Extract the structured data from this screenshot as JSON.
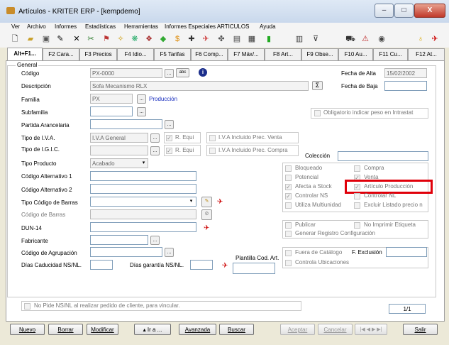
{
  "window": {
    "title": "Artículos - KRITER ERP - [kempdemo]",
    "min": "–",
    "max": "□",
    "close": "X"
  },
  "menu": [
    "Ver",
    "Archivo",
    "Informes",
    "Estadísticas",
    "Herramientas",
    "Informes Especiales ARTICULOS",
    "Ayuda"
  ],
  "tabs": [
    "Alt+F1...",
    "F2 Cara...",
    "F3 Precios",
    "F4 Idio...",
    "F5 Tarifas",
    "F6 Comp...",
    "F7 Máx/...",
    "F8 Art...",
    "F9 Obse...",
    "F10 Au...",
    "F11 Cu...",
    "F12 At..."
  ],
  "general_label": "General",
  "labels": {
    "codigo": "Código",
    "descripcion": "Descripción",
    "familia": "Familia",
    "subfamilia": "Subfamilia",
    "partida": "Partida Arancelaria",
    "tipo_iva": "Tipo de I.V.A.",
    "tipo_igic": "Tipo de I.G.I.C.",
    "tipo_producto": "Tipo Producto",
    "cod_alt1": "Código Alternativo 1",
    "cod_alt2": "Código Alternativo 2",
    "tipo_cod_barras": "Tipo Código de Barras",
    "cod_barras": "Código de Barras",
    "dun": "DUN-14",
    "fabricante": "Fabricante",
    "cod_agrup": "Código de Agrupación",
    "dias_cad": "Días Caducidad NS/NL.",
    "dias_gar": "Días garantía NS/NL.",
    "plantilla": "Plantilla Cod. Art.",
    "fecha_alta": "Fecha de Alta",
    "fecha_baja": "Fecha de Baja",
    "coleccion": "Colección",
    "f_exclusion": "F. Exclusión"
  },
  "values": {
    "codigo": "PX-0000",
    "descripcion": "Sofa Mecanismo RLX",
    "familia": "PX",
    "familia_link": "Producción",
    "tipo_iva": "I.V.A General",
    "tipo_producto": "Acabado",
    "fecha_alta": "15/02/2002",
    "page": "1/1",
    "abc": "abc"
  },
  "checks": {
    "obligatorio_peso": "Obligatorio indicar peso en Intrastat",
    "r_equi": "R. Equi",
    "iva_incl_venta": "I.V.A Incluido Prec. Venta",
    "iva_incl_compra": "I.V.A Incluido Prec. Compra",
    "bloqueado": "Bloqueado",
    "compra": "Compra",
    "potencial": "Potencial",
    "venta": "Venta",
    "afecta_stock": "Afecta a Stock",
    "articulo_produccion": "Artículo Producción",
    "controlar_ns": "Controlar NS",
    "controlar_nl": "Controlar NL",
    "utiliza_multiunidad": "Utiliza Multiunidad",
    "excluir_listado": "Excluir Listado precio n",
    "publicar": "Publicar",
    "no_imprimir": "No Imprimir Etiqueta",
    "generar_registro": "Generar Registro Configuración",
    "fuera_catalogo": "Fuera de Catálogo",
    "controla_ubicaciones": "Controla Ubicaciones",
    "no_pide_ns": "No Pide NS/NL al realizar pedido de cliente, para vincular."
  },
  "buttons": {
    "nuevo": "Nuevo",
    "borrar": "Borrar",
    "modificar": "Modificar",
    "ir_a": "▴ Ir a ...",
    "avanzada": "Avanzada",
    "buscar": "Buscar",
    "aceptar": "Aceptar",
    "cancelar": "Cancelar",
    "salir": "Salir",
    "nav": "|◀ ◀ ▶ ▶|"
  }
}
